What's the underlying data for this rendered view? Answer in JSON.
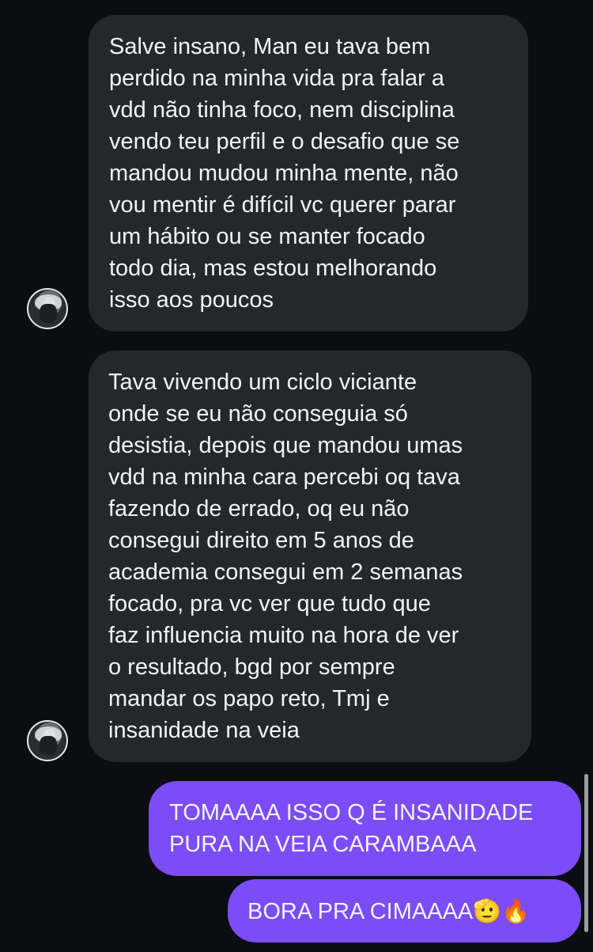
{
  "messages": {
    "incoming": [
      "Salve insano, Man eu tava bem\nperdido na minha vida pra falar a\nvdd não tinha foco, nem disciplina\nvendo teu perfil e o desafio que se\nmandou mudou minha mente, não\nvou mentir é difícil vc querer parar\num hábito ou se manter focado\ntodo dia, mas estou melhorando\nisso aos poucos",
      "Tava vivendo um ciclo viciante\nonde se eu não conseguia só\ndesistia, depois que mandou umas\nvdd na minha cara percebi oq tava\nfazendo de errado, oq eu não\nconsegui direito em 5 anos de\nacademia consegui em 2 semanas\nfocado, pra vc ver que tudo que\nfaz influencia muito na hora de ver\no resultado, bgd por sempre\nmandar os papo reto, Tmj e\ninsanidade na veia"
    ],
    "outgoing": [
      "TOMAAAA ISSO Q É INSANIDADE\nPURA NA VEIA CARAMBAAA",
      "BORA PRA CIMAAAA"
    ],
    "outgoing_emoji": "🫡🔥"
  },
  "colors": {
    "background": "#0b0d13",
    "incoming_bubble": "#25272d",
    "outgoing_bubble": "#7b4cf7",
    "text": "#f2f3f5"
  },
  "icons": {
    "avatar": "user-avatar-icon"
  }
}
